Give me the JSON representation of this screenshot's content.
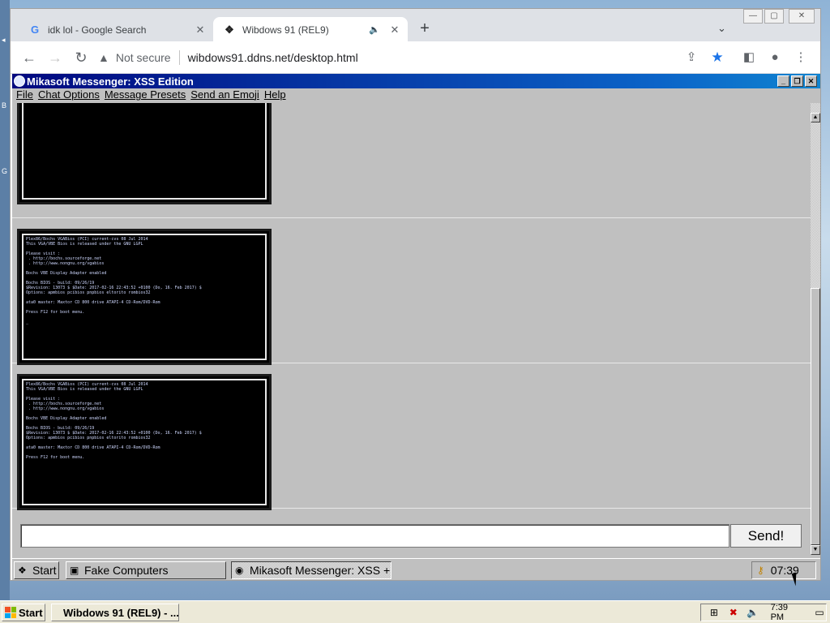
{
  "browser": {
    "tabs": [
      {
        "title": "idk lol - Google Search",
        "favicon": "google-g",
        "active": false
      },
      {
        "title": "Wibdows 91 (REL9)",
        "favicon": "wibdows-logo",
        "active": true,
        "audio": true
      }
    ],
    "new_tab": "+",
    "tab_list": "⌄",
    "security_label": "Not secure",
    "url": "wibdows91.ddns.net/desktop.html",
    "bookmarked": true
  },
  "messenger": {
    "title": "Mikasoft Messenger: XSS Edition",
    "menu": [
      "File",
      "Chat Options",
      "Message Presets",
      "Send an Emoji",
      "Help"
    ],
    "screens": [
      {
        "lines": ""
      },
      {
        "lines": "Plex86/Bochs VGABios (PCI) current-cvs 08 Jul 2014\nThis VGA/VBE Bios is released under the GNU LGPL\n\nPlease visit :\n . http://bochs.sourceforge.net\n . http://www.nongnu.org/vgabios\n\nBochs VBE Display Adapter enabled\n\nBochs BIOS - build: 09/26/19\n$Revision: 13073 $ $Date: 2017-02-16 22:43:52 +0100 (Do, 16. Feb 2017) $\nOptions: apmbios pcibios pnpbios eltorito rombios32\n\nata0 master: Maxtor CD 800 drive ATAPI-4 CD-Rom/DVD-Rom\n\nPress F12 for boot menu.\n\n_"
      },
      {
        "lines": "Plex86/Bochs VGABios (PCI) current-cvs 08 Jul 2014\nThis VGA/VBE Bios is released under the GNU LGPL\n\nPlease visit :\n . http://bochs.sourceforge.net\n . http://www.nongnu.org/vgabios\n\nBochs VBE Display Adapter enabled\n\nBochs BIOS - build: 09/26/19\n$Revision: 13073 $ $Date: 2017-02-16 22:43:52 +0100 (Do, 16. Feb 2017) $\nOptions: apmbios pcibios pnpbios eltorito rombios32\n\nata0 master: Maxtor CD 800 drive ATAPI-4 CD-Rom/DVD-Rom\n\nPress F12 for boot menu."
      }
    ],
    "input_value": "",
    "send_label": "Send!"
  },
  "w91_taskbar": {
    "start_label": "Start",
    "tasks": [
      {
        "label": "Fake Computers",
        "active": false
      },
      {
        "label": "Mikasoft Messenger: XSS +",
        "active": true
      }
    ],
    "clock": "07:39"
  },
  "host_taskbar": {
    "start_label": "Start",
    "task_label": "Wibdows 91 (REL9) - ...",
    "clock": "7:39 PM"
  },
  "colors": {
    "titlebar_start": "#00087f",
    "titlebar_end": "#1084d0",
    "window_face": "#c0c0c0"
  }
}
